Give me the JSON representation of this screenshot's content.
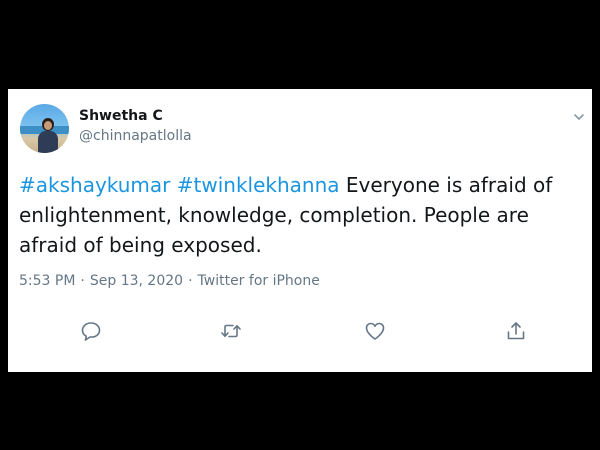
{
  "tweet": {
    "display_name": "Shwetha C",
    "handle": "@chinnapatlolla",
    "hashtags": [
      "#akshaykumar",
      "#twinklekhanna"
    ],
    "body_text": "Everyone is afraid of enlightenment, knowledge, completion. People are afraid of being exposed.",
    "time": "5:53 PM",
    "date": "Sep 13, 2020",
    "separator": "·",
    "source": "Twitter for iPhone"
  },
  "icons": {
    "more": "chevron-down-icon",
    "reply": "reply-icon",
    "retweet": "retweet-icon",
    "like": "heart-icon",
    "share": "share-icon"
  },
  "colors": {
    "hashtag": "#1b95e0",
    "text": "#14171a",
    "muted": "#657786",
    "background": "#000000",
    "card": "#ffffff"
  }
}
